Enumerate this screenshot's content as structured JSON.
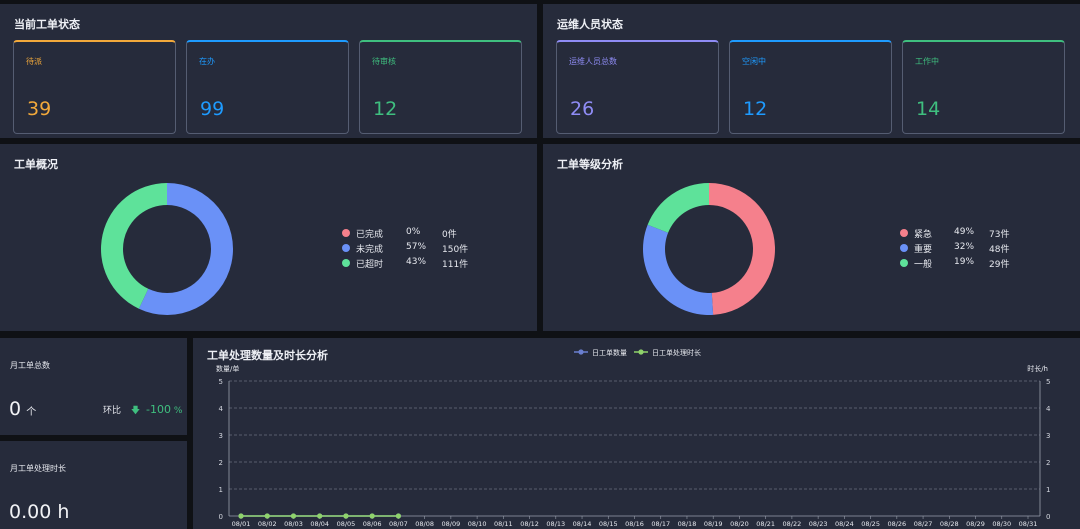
{
  "work_order_status": {
    "title": "当前工单状态",
    "cards": [
      {
        "label": "待派",
        "value": "39",
        "color": "#f2a93b"
      },
      {
        "label": "在办",
        "value": "99",
        "color": "#1e9bff"
      },
      {
        "label": "待审核",
        "value": "12",
        "color": "#3fbf7f"
      }
    ]
  },
  "staff_status": {
    "title": "运维人员状态",
    "cards": [
      {
        "label": "运维人员总数",
        "value": "26",
        "color": "#8f8cf5"
      },
      {
        "label": "空闲中",
        "value": "12",
        "color": "#1e9bff"
      },
      {
        "label": "工作中",
        "value": "14",
        "color": "#3fbf7f"
      }
    ]
  },
  "overview": {
    "title": "工单概况",
    "legend": [
      {
        "name": "已完成",
        "pct": "0%",
        "count": "0件",
        "fraction": 0.0,
        "color": "#f5808c"
      },
      {
        "name": "未完成",
        "pct": "57%",
        "count": "150件",
        "fraction": 0.57,
        "color": "#6a91f7"
      },
      {
        "name": "已超时",
        "pct": "43%",
        "count": "111件",
        "fraction": 0.43,
        "color": "#5ee29a"
      }
    ]
  },
  "level": {
    "title": "工单等级分析",
    "legend": [
      {
        "name": "紧急",
        "pct": "49%",
        "count": "73件",
        "fraction": 0.49,
        "color": "#f5808c"
      },
      {
        "name": "重要",
        "pct": "32%",
        "count": "48件",
        "fraction": 0.32,
        "color": "#6a91f7"
      },
      {
        "name": "一般",
        "pct": "19%",
        "count": "29件",
        "fraction": 0.19,
        "color": "#5ee29a"
      }
    ]
  },
  "monthly_total": {
    "label": "月工单总数",
    "value": "0",
    "unit": "个",
    "compare_label": "环比",
    "compare_value": "-100",
    "compare_unit": "%"
  },
  "monthly_duration": {
    "label": "月工单处理时长",
    "value": "0.00 h"
  },
  "chart_data": {
    "type": "line",
    "title": "工单处理数量及时长分析",
    "ylabel": "数量/单",
    "y2label": "时长/h",
    "ylim": [
      0,
      5
    ],
    "y2lim": [
      0,
      5
    ],
    "yticks": [
      0,
      1,
      2,
      3,
      4,
      5
    ],
    "grid": true,
    "legend_position": "top",
    "x": [
      "08/01",
      "08/02",
      "08/03",
      "08/04",
      "08/05",
      "08/06",
      "08/07",
      "08/08",
      "08/09",
      "08/10",
      "08/11",
      "08/12",
      "08/13",
      "08/14",
      "08/15",
      "08/16",
      "08/17",
      "08/18",
      "08/19",
      "08/20",
      "08/21",
      "08/22",
      "08/23",
      "08/24",
      "08/25",
      "08/26",
      "08/27",
      "08/28",
      "08/29",
      "08/30",
      "08/31"
    ],
    "series": [
      {
        "name": "日工单数量",
        "color": "#6a7fd0",
        "values": [
          0,
          0,
          0,
          0,
          0,
          0,
          0,
          null,
          null,
          null,
          null,
          null,
          null,
          null,
          null,
          null,
          null,
          null,
          null,
          null,
          null,
          null,
          null,
          null,
          null,
          null,
          null,
          null,
          null,
          null,
          null
        ]
      },
      {
        "name": "日工单处理时长",
        "color": "#8fd36b",
        "values": [
          0,
          0,
          0,
          0,
          0,
          0,
          0,
          null,
          null,
          null,
          null,
          null,
          null,
          null,
          null,
          null,
          null,
          null,
          null,
          null,
          null,
          null,
          null,
          null,
          null,
          null,
          null,
          null,
          null,
          null,
          null
        ]
      }
    ]
  }
}
